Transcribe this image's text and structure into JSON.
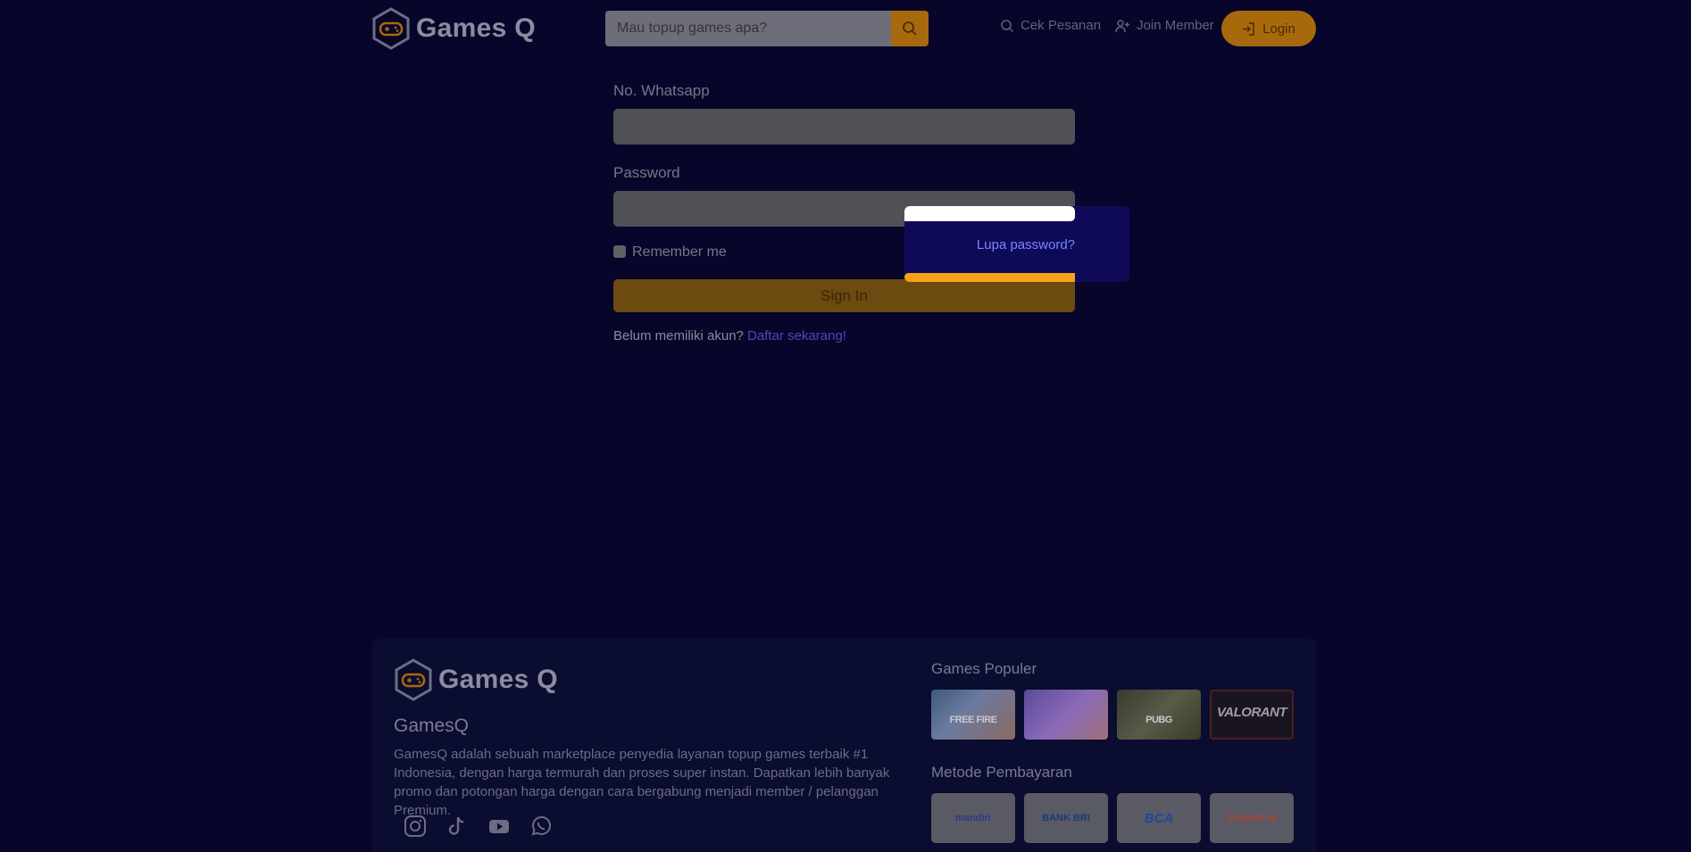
{
  "header": {
    "logo_text": "Games Q",
    "search": {
      "placeholder": "Mau topup games apa?"
    },
    "nav": [
      {
        "label": "Cek Pesanan",
        "icon": "search-icon"
      },
      {
        "label": "Join Member",
        "icon": "user-plus-icon"
      }
    ],
    "login_label": "Login"
  },
  "form": {
    "whatsapp_label": "No. Whatsapp",
    "password_label": "Password",
    "remember_label": "Remember me",
    "forgot_label": "Lupa password?",
    "signin_label": "Sign In",
    "register_prompt": "Belum memiliki akun?",
    "register_link": "Daftar sekarang!"
  },
  "footer": {
    "logo_text": "Games Q",
    "brand": "GamesQ",
    "description": "GamesQ adalah sebuah marketplace penyedia layanan topup games terbaik #1 Indonesia, dengan harga termurah dan proses super instan. Dapatkan lebih banyak promo dan potongan harga dengan cara bergabung menjadi member / pelanggan Premium.",
    "social": [
      "instagram-icon",
      "tiktok-icon",
      "youtube-icon",
      "whatsapp-icon"
    ],
    "popular_heading": "Games Populer",
    "games": [
      {
        "title": "FREE FIRE"
      },
      {
        "title": ""
      },
      {
        "title": "PUBG"
      },
      {
        "title": "VALORANT"
      }
    ],
    "payment_heading": "Metode Pembayaran",
    "payments": [
      {
        "label": "mandiri",
        "color": "#2a3a8a"
      },
      {
        "label": "BANK BRI",
        "color": "#1a3a7a"
      },
      {
        "label": "BCA",
        "color": "#1a4aa0"
      },
      {
        "label": "ShopeePay",
        "color": "#c0402a"
      }
    ]
  },
  "colors": {
    "background": "#07062a",
    "accent": "#a8690c",
    "popover": "#0f0a57",
    "link": "#7a86ff"
  }
}
